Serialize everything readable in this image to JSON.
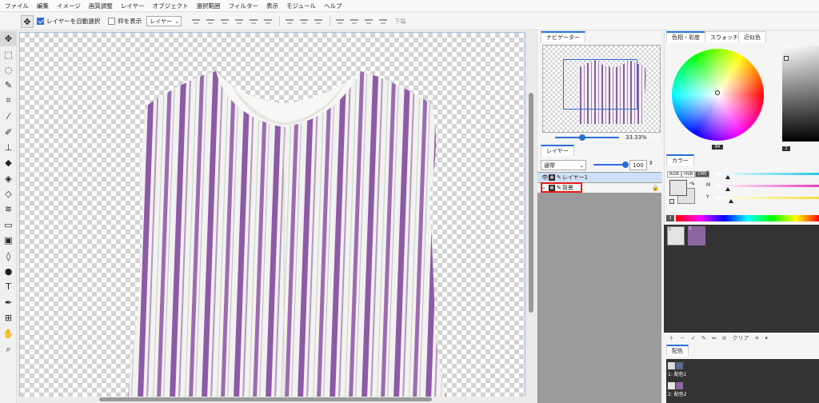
{
  "menu": [
    "ファイル",
    "編集",
    "イメージ",
    "画質調整",
    "レイヤー",
    "オブジェクト",
    "選択範囲",
    "フィルター",
    "表示",
    "モジュール",
    "ヘルプ"
  ],
  "options": {
    "auto_select_label": "レイヤーを自動選択",
    "show_frame_label": "枠を表示",
    "layer_select_value": "レイヤー",
    "under_label": "下端"
  },
  "tools": [
    "move-tool",
    "marquee-tool",
    "lasso-tool",
    "quick-select-tool",
    "crop-tool",
    "eyedropper-tool",
    "brush-tool",
    "stamp-tool",
    "eraser-tool",
    "fill-tool",
    "color-replace-tool",
    "gradient-tool",
    "rectangle-tool",
    "retouch-tool",
    "blur-tool",
    "dodge-tool",
    "text-tool",
    "pen-tool",
    "transform-tool",
    "hand-tool",
    "zoom-tool"
  ],
  "navigator": {
    "tab": "ナビゲーター",
    "zoom": "33.33%"
  },
  "layers": {
    "tab": "レイヤー",
    "blend_mode": "通常",
    "opacity": "100",
    "items": [
      {
        "name": "レイヤー1",
        "selected": true
      },
      {
        "name": "背景",
        "selected": false,
        "locked": true
      }
    ]
  },
  "color_picker": {
    "tabs": [
      "色相・彩度",
      "スウォッチ",
      "近似色"
    ],
    "hue_value": "84",
    "value_value": "2"
  },
  "color_panel": {
    "tab": "カラー",
    "modes": [
      "RGB",
      "HSB",
      "CMY"
    ],
    "active_mode": "CMY",
    "channels": [
      "C",
      "M",
      "Y"
    ],
    "spectrum_index": "2"
  },
  "palette": {
    "swatches": [
      {
        "index": "1",
        "color": "#e4e5e2"
      },
      {
        "index": "2",
        "color": "#8d66a0"
      }
    ],
    "clear_label": "クリア"
  },
  "scheme": {
    "tab": "配色",
    "items": [
      {
        "name": "1: 配色1",
        "colors": [
          "#d7dbe4",
          "#cfd4de",
          "#5a6b8a"
        ]
      },
      {
        "name": "2: 配色2",
        "colors": [
          "#e4e5e2",
          "#8d66a0",
          "#8d66a0"
        ]
      }
    ]
  },
  "colors": {
    "accent": "#2b6fd6",
    "stripe": "#8d5aa8",
    "highlight": "#e52020"
  }
}
